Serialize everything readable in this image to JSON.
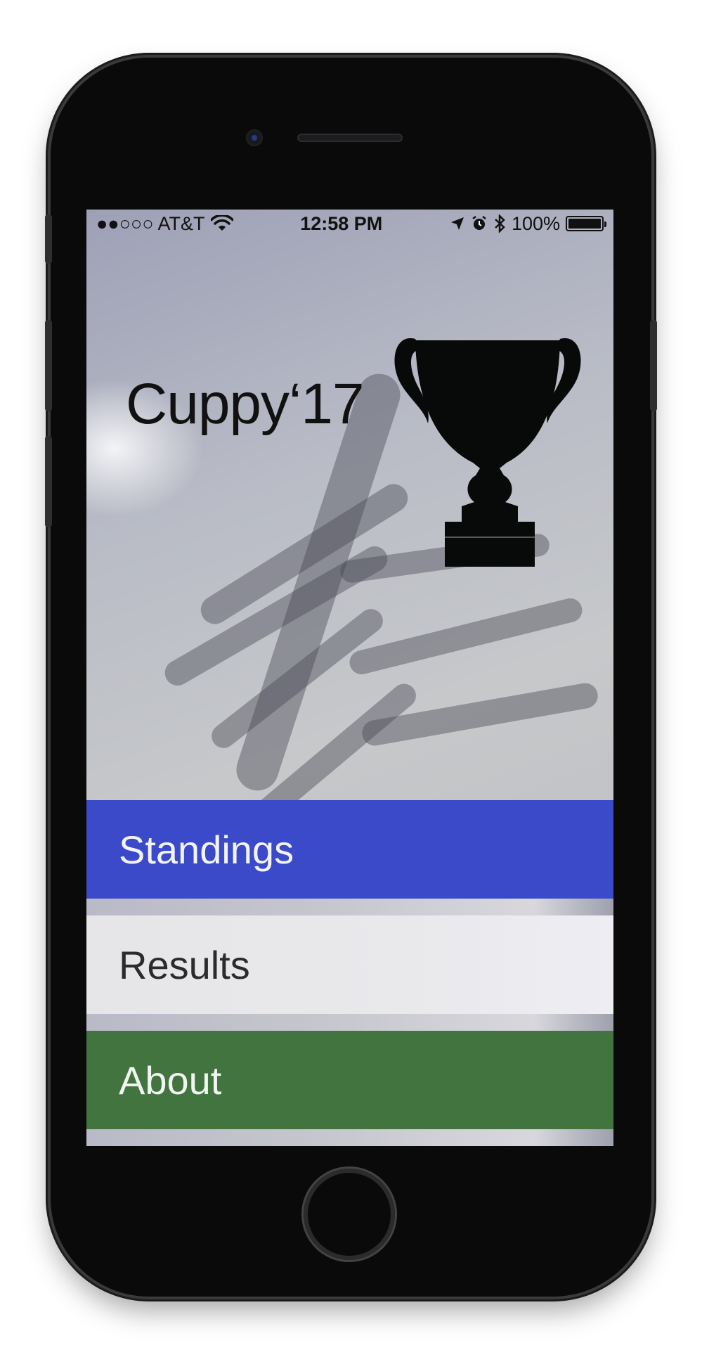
{
  "status_bar": {
    "carrier": "●●○○○ AT&T",
    "time": "12:58 PM",
    "battery": "100%",
    "battery_level": 1.0
  },
  "app": {
    "title": "Cuppy‘17"
  },
  "menu": {
    "items": [
      {
        "label": "Standings",
        "color": "#3a4ac8"
      },
      {
        "label": "Results",
        "color": "#e8e8eb"
      },
      {
        "label": "About",
        "color": "#41743f"
      }
    ]
  },
  "icons": [
    "wifi-icon",
    "location-arrow-icon",
    "alarm-icon",
    "bluetooth-icon",
    "battery-icon",
    "trophy-icon"
  ]
}
